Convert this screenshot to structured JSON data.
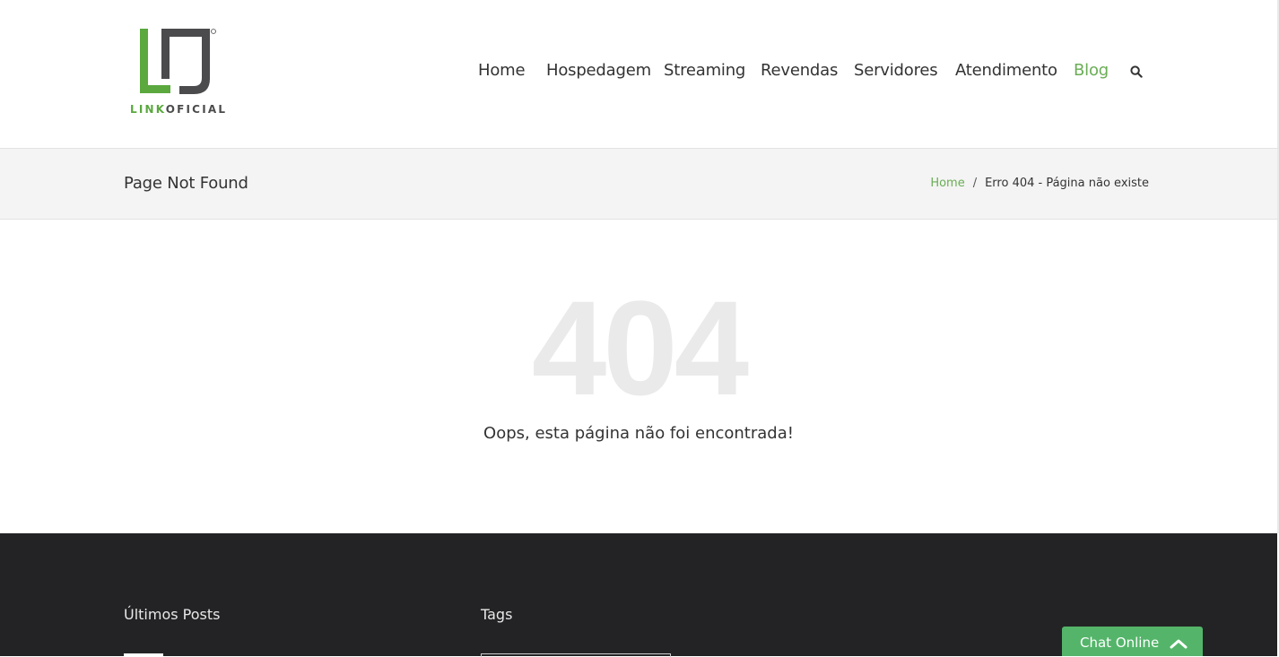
{
  "header": {
    "logo_text_1": "LINK",
    "logo_text_2": "OFICIAL",
    "nav": [
      "Home",
      "Hospedagem",
      "Streaming",
      "Revendas",
      "Servidores",
      "Atendimento",
      "Blog"
    ],
    "active_nav": "Blog"
  },
  "titlebar": {
    "page_title": "Page Not Found",
    "breadcrumb_home": "Home",
    "breadcrumb_sep": "/",
    "breadcrumb_current": "Erro 404 - Página não existe"
  },
  "main": {
    "code": "404",
    "message": "Oops, esta página não foi encontrada!"
  },
  "footer": {
    "col1_title": "Últimos Posts",
    "col2_title": "Tags"
  },
  "chat": {
    "label": "Chat Online"
  },
  "colors": {
    "accent": "#6aad55",
    "logo_green": "#5aa83e",
    "logo_gray": "#4b4b4d",
    "footer_bg": "#232325",
    "chat_bg": "#54b56a"
  },
  "icons": {
    "search": "search-icon",
    "chat_toggle": "chevron-up-icon"
  }
}
